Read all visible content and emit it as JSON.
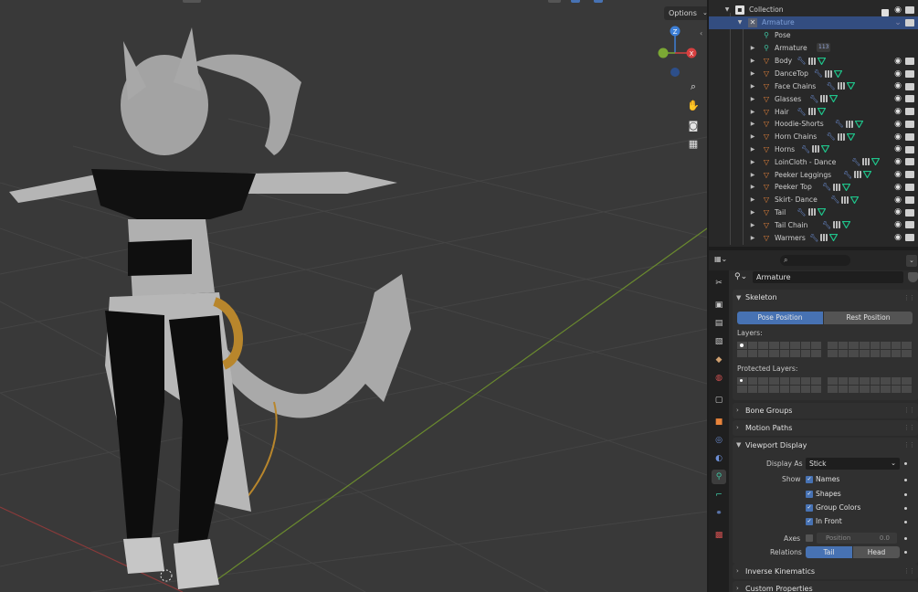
{
  "viewport": {
    "options_label": "Options",
    "nav_tools": [
      "zoom-icon",
      "hand-icon",
      "camera-icon",
      "grid-icon"
    ],
    "gizmo": {
      "z": "Z",
      "x": "X"
    }
  },
  "outliner": {
    "collection": "Collection",
    "armature_object": "Armature",
    "pose": "Pose",
    "armature_data": "Armature",
    "badge": "113",
    "items": [
      "Body",
      "DanceTop",
      "Face Chains",
      "Glasses",
      "Hair",
      "Hoodie-Shorts",
      "Horn Chains",
      "Horns",
      "LoinCloth - Dance",
      "Peeker Leggings",
      "Peeker Top",
      "Skirt- Dance",
      "Tail",
      "Tail Chain",
      "Warmers"
    ]
  },
  "properties": {
    "search_placeholder": "",
    "context_name": "Armature",
    "skeleton": {
      "title": "Skeleton",
      "pose_position": "Pose Position",
      "rest_position": "Rest Position",
      "layers_label": "Layers:",
      "protected_label": "Protected Layers:"
    },
    "bone_groups": "Bone Groups",
    "motion_paths": "Motion Paths",
    "viewport_display": {
      "title": "Viewport Display",
      "display_as_label": "Display As",
      "display_as_value": "Stick",
      "show_label": "Show",
      "names": "Names",
      "shapes": "Shapes",
      "group_colors": "Group Colors",
      "in_front": "In Front",
      "axes_label": "Axes",
      "position_label": "Position",
      "position_value": "0.0",
      "relations_label": "Relations",
      "tail": "Tail",
      "head": "Head"
    },
    "inverse_kinematics": "Inverse Kinematics",
    "custom_properties": "Custom Properties"
  },
  "colors": {
    "selection": "#334d80",
    "accent_blue": "#4772b3",
    "object_orange": "#e9843b",
    "mesh_green": "#1fc38a"
  }
}
